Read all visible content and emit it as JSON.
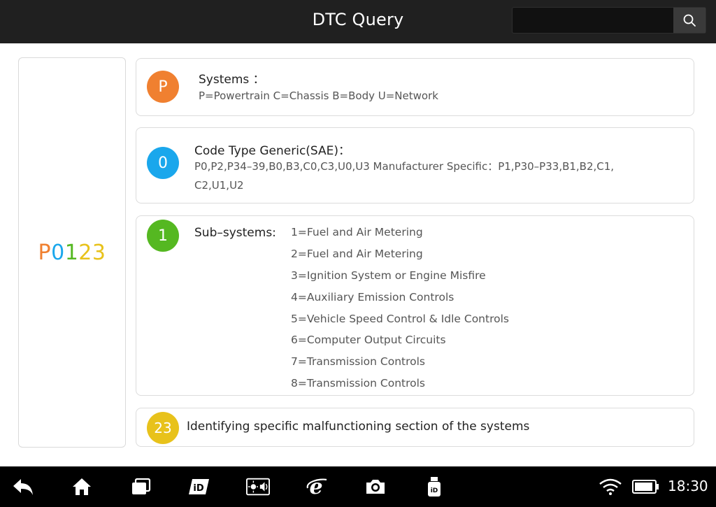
{
  "header": {
    "title": "DTC Query",
    "search_placeholder": ""
  },
  "code": {
    "chars": [
      {
        "ch": "P",
        "color": "#f08030"
      },
      {
        "ch": "0",
        "color": "#1aa7ec"
      },
      {
        "ch": "1",
        "color": "#55b821"
      },
      {
        "ch": "2",
        "color": "#e8c21b"
      },
      {
        "ch": "3",
        "color": "#e8c21b"
      }
    ]
  },
  "cards": {
    "systems": {
      "badge": "P",
      "badge_color": "#f08030",
      "heading": "Systems  ：",
      "text": "P=Powertrain  C=Chassis  B=Body U=Network"
    },
    "code_type": {
      "badge": "0",
      "badge_color": "#1aa7ec",
      "heading": "Code Type Generic(SAE)：",
      "text": "P0,P2,P34–39,B0,B3,C0,C3,U0,U3 Manufacturer Specific：P1,P30–P33,B1,B2,C1, C2,U1,U2"
    },
    "subsystems": {
      "badge": "1",
      "badge_color": "#55b821",
      "heading": "Sub–systems:",
      "items": [
        "1=Fuel and Air Metering",
        "2=Fuel and Air Metering",
        "3=Ignition System or Engine Misfire",
        "4=Auxiliary Emission Controls",
        "5=Vehicle Speed Control & Idle Controls",
        "6=Computer Output Circuits",
        "7=Transmission Controls",
        "8=Transmission Controls"
      ]
    },
    "section": {
      "badge": "23",
      "badge_color": "#e8c21b",
      "text": "Identifying specific malfunctioning section of the systems"
    }
  },
  "navbar": {
    "icons": [
      "back-icon",
      "home-icon",
      "recent-apps-icon",
      "brand-app-icon",
      "brightness-volume-icon",
      "browser-icon",
      "camera-icon",
      "vci-device-icon"
    ],
    "status_icons": [
      "wifi-icon",
      "battery-icon"
    ],
    "time": "18:30"
  },
  "colors": {
    "header_bg": "#202020",
    "nav_bg": "#000000",
    "border": "#dcdcdc"
  }
}
